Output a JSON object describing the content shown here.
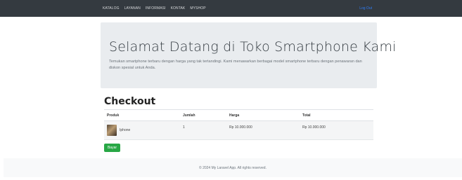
{
  "navbar": {
    "links": [
      "KATALOG",
      "LAYANAN",
      "INFORMASI",
      "KONTAK",
      "MYSHOP"
    ],
    "logout_label": "Log Out"
  },
  "hero": {
    "title": "Selamat Datang di Toko Smartphone Kami",
    "lead": "Temukan smartphone terbaru dengan harga yang tak tertandingi. Kami menawarkan berbagai model smartphone terbaru dengan penawaran dan diskon spesial untuk Anda."
  },
  "checkout": {
    "title": "Checkout",
    "columns": [
      "Produk",
      "Jumlah",
      "Harga",
      "Total"
    ],
    "rows": [
      {
        "product": "Iphone",
        "qty": "1",
        "price": "Rp 10.000.000",
        "total": "Rp 10.000.000"
      }
    ],
    "pay_label": "Bayar"
  },
  "footer": {
    "text": "© 2024 My Laravel App. All rights reserved."
  },
  "colors": {
    "navbar_bg": "#343a40",
    "jumbotron_bg": "#e9ecef",
    "pay_button": "#28a745",
    "logout_link": "#2f7df6"
  }
}
